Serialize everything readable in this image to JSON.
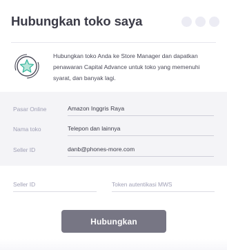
{
  "header": {
    "title": "Hubungkan toko saya"
  },
  "info": {
    "icon": "star-badge-icon",
    "text": "Hubungkan toko Anda ke Store Manager dan dapatkan penawaran Capital Advance untuk toko yang memenuhi syarat, dan banyak lagi."
  },
  "form": {
    "rows": [
      {
        "label": "Pasar Online",
        "value": "Amazon Inggris Raya"
      },
      {
        "label": "Nama toko",
        "value": "Telepon dan lainnya"
      },
      {
        "label": "Seller ID",
        "value": "danb@phones-more.com"
      }
    ]
  },
  "credentials": {
    "seller_id_placeholder": "Seller ID",
    "mws_token_placeholder": "Token autentikasi MWS"
  },
  "actions": {
    "connect_label": "Hubungkan"
  },
  "colors": {
    "accent_star": "#2fb39a",
    "button_bg": "#777684",
    "panel_bg": "#f4f4f7"
  }
}
